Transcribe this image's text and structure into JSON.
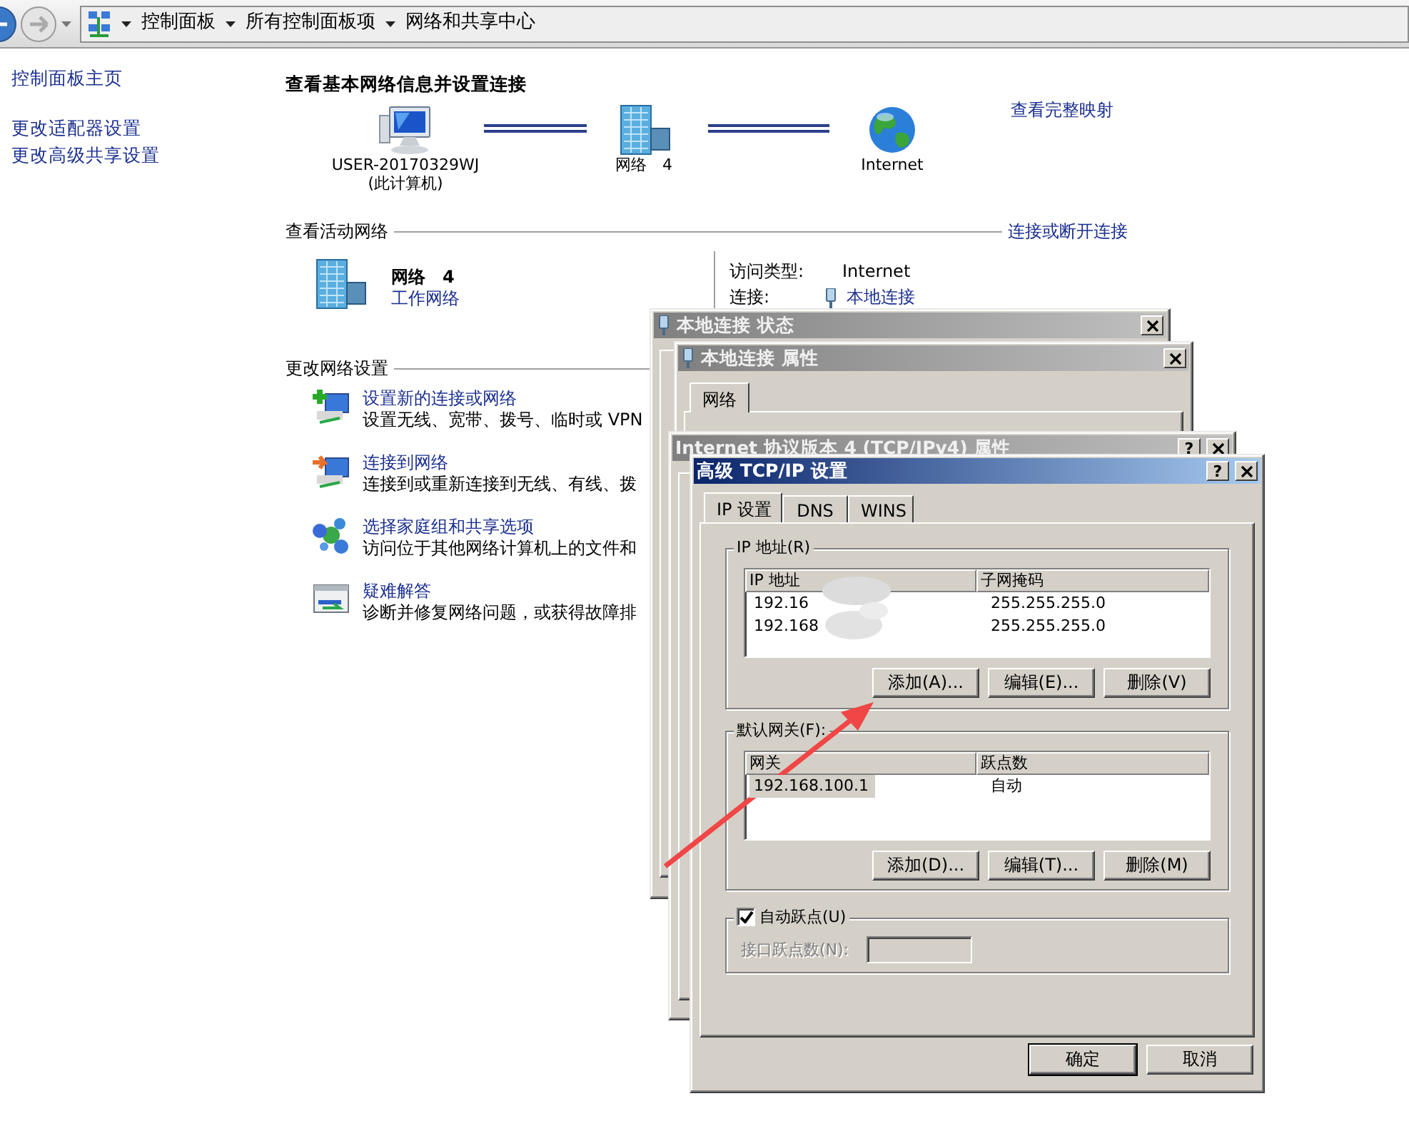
{
  "address_bar": {
    "breadcrumbs": [
      "控制面板",
      "所有控制面板项",
      "网络和共享中心"
    ]
  },
  "sidebar": {
    "items": [
      {
        "label": "控制面板主页"
      },
      {
        "label": "更改适配器设置"
      },
      {
        "label": "更改高级共享设置"
      }
    ]
  },
  "header": "查看基本网络信息并设置连接",
  "network_map": {
    "nodes": [
      {
        "kind": "computer",
        "label": "USER-20170329WJ",
        "sublabel": "(此计算机)"
      },
      {
        "kind": "network",
        "label": "网络　4"
      },
      {
        "kind": "internet",
        "label": "Internet"
      }
    ],
    "link": "查看完整映射"
  },
  "active_networks": {
    "heading": "查看活动网络",
    "link": "连接或断开连接",
    "name": "网络　4",
    "category": "工作网络",
    "fields": [
      {
        "kind": "text",
        "label": "访问类型:",
        "value": "Internet"
      },
      {
        "kind": "link",
        "label": "连接:",
        "value": "本地连接"
      }
    ]
  },
  "change_settings": {
    "heading": "更改网络设置",
    "tasks": [
      {
        "kind": "setup",
        "title": "设置新的连接或网络",
        "description": "设置无线、宽带、拨号、临时或 VPN"
      },
      {
        "kind": "connect",
        "title": "连接到网络",
        "description": "连接到或重新连接到无线、有线、拨"
      },
      {
        "kind": "homegroup",
        "title": "选择家庭组和共享选项",
        "description": "访问位于其他网络计算机上的文件和"
      },
      {
        "kind": "troubleshoot",
        "title": "疑难解答",
        "description": "诊断并修复网络问题，或获得故障排"
      }
    ]
  },
  "windows": [
    {
      "title": "本地连接 状态",
      "active": false
    },
    {
      "title": "本地连接 属性",
      "active": false,
      "tabs": [
        {
          "label": "网络",
          "selected": true
        }
      ]
    },
    {
      "title": "Internet 协议版本 4 (TCP/IPv4) 属性",
      "active": false,
      "help": "?"
    }
  ],
  "advanced": {
    "title": "高级 TCP/IP 设置",
    "active": true,
    "help": "?",
    "tabs": [
      {
        "label": "IP 设置",
        "selected": true
      },
      {
        "label": "DNS",
        "selected": false
      },
      {
        "label": "WINS",
        "selected": false
      }
    ],
    "ip_group": {
      "legend": "IP 地址(R)",
      "columns": [
        "IP 地址",
        "子网掩码"
      ],
      "rows": [
        {
          "cells": [
            "192.16",
            "255.255.255.0"
          ],
          "selected": false
        },
        {
          "cells": [
            "192.168",
            "255.255.255.0"
          ],
          "selected": false
        }
      ],
      "buttons": [
        "添加(A)...",
        "编辑(E)...",
        "删除(V)"
      ]
    },
    "gateway_group": {
      "legend": "默认网关(F):",
      "columns": [
        "网关",
        "跃点数"
      ],
      "rows": [
        {
          "cells": [
            "192.168.100.1",
            "自动"
          ],
          "selected": true
        }
      ],
      "buttons": [
        "添加(D)...",
        "编辑(T)...",
        "删除(M)"
      ]
    },
    "metric": {
      "checkbox": {
        "label": "自动跃点(U)",
        "checked": true
      },
      "field_label": "接口跃点数(N):",
      "disabled": true
    },
    "buttons": [
      {
        "label": "确定",
        "default": true
      },
      {
        "label": "取消",
        "default": false
      }
    ]
  }
}
